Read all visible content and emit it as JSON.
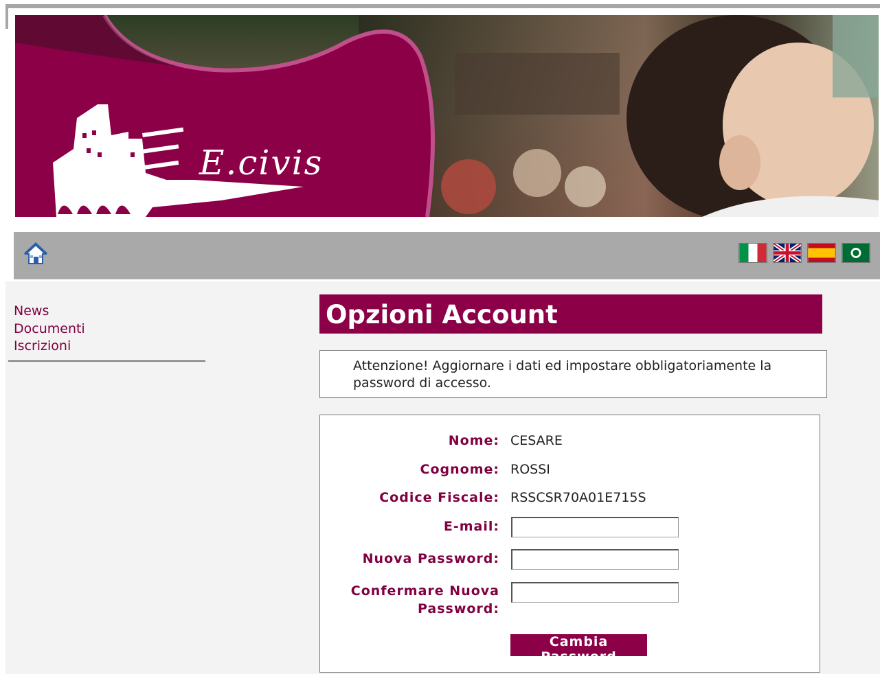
{
  "banner": {
    "logo_text": "E.civis"
  },
  "navbar": {
    "home_icon": "home-icon",
    "languages": [
      {
        "name": "flag-italy-icon",
        "colors": [
          "#009246",
          "#ffffff",
          "#ce2b37"
        ]
      },
      {
        "name": "flag-uk-icon",
        "colors": [
          "#012169",
          "#ffffff",
          "#c8102e"
        ]
      },
      {
        "name": "flag-spain-icon",
        "colors": [
          "#c60b1e",
          "#ffc400"
        ]
      },
      {
        "name": "flag-arabic-icon",
        "colors": [
          "#006c35",
          "#ffffff"
        ]
      }
    ]
  },
  "sidebar": {
    "items": [
      {
        "label": "News"
      },
      {
        "label": "Documenti"
      },
      {
        "label": "Iscrizioni"
      }
    ]
  },
  "page": {
    "title": "Opzioni Account",
    "notice": "Attenzione! Aggiornare i dati ed impostare obbligatoriamente la password di accesso."
  },
  "form": {
    "nome_label": "Nome:",
    "nome_value": "CESARE",
    "cognome_label": "Cognome:",
    "cognome_value": "ROSSI",
    "cf_label": "Codice Fiscale:",
    "cf_value": "RSSCSR70A01E715S",
    "email_label": "E-mail:",
    "email_value": "",
    "new_password_label": "Nuova Password:",
    "new_password_value": "",
    "confirm_label_line1": "Confermare Nuova",
    "confirm_label_line2": "Password:",
    "confirm_value": "",
    "submit_label": "Cambia Password"
  },
  "colors": {
    "brand": "#8c0048",
    "nav_gray": "#a9a9a9",
    "content_bg": "#f3f3f3"
  }
}
